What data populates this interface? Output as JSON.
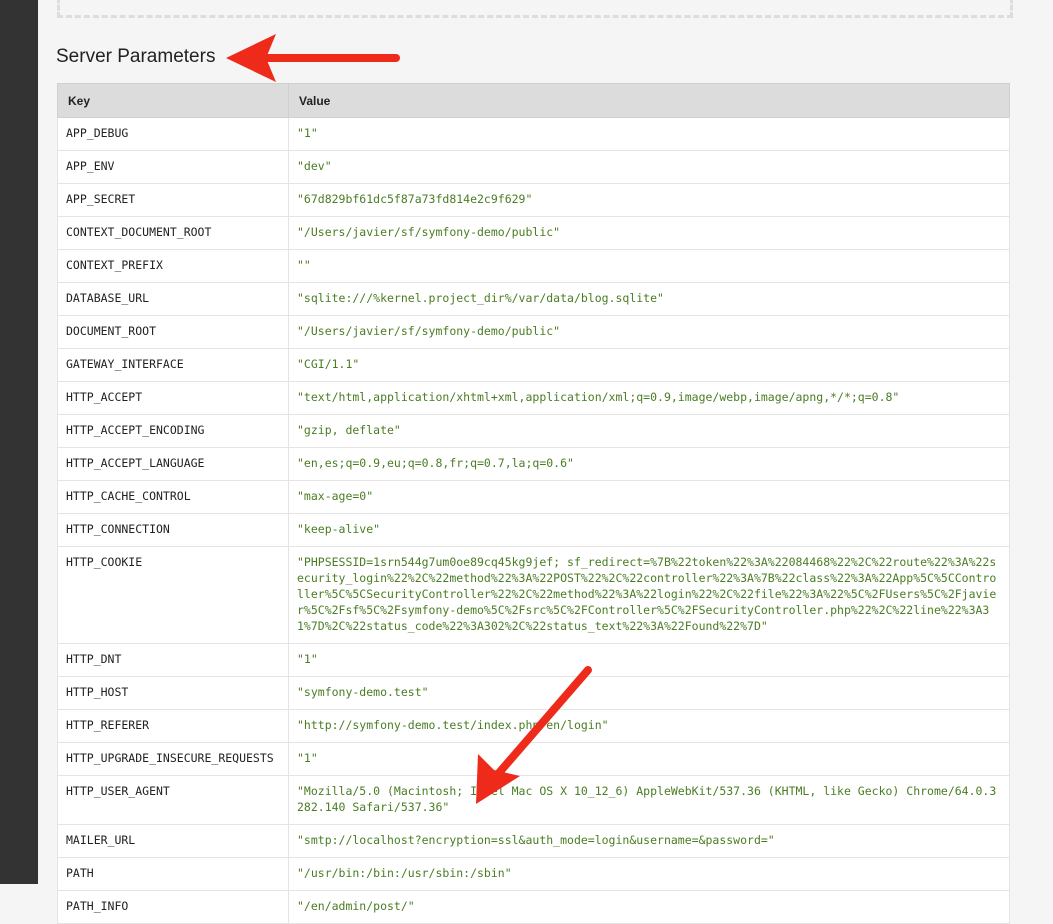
{
  "section_title": "Server Parameters",
  "table": {
    "headers": {
      "key": "Key",
      "value": "Value"
    },
    "rows": [
      {
        "key": "APP_DEBUG",
        "value": "\"1\""
      },
      {
        "key": "APP_ENV",
        "value": "\"dev\""
      },
      {
        "key": "APP_SECRET",
        "value": "\"67d829bf61dc5f87a73fd814e2c9f629\""
      },
      {
        "key": "CONTEXT_DOCUMENT_ROOT",
        "value": "\"/Users/javier/sf/symfony-demo/public\""
      },
      {
        "key": "CONTEXT_PREFIX",
        "value": "\"\""
      },
      {
        "key": "DATABASE_URL",
        "value": "\"sqlite:///%kernel.project_dir%/var/data/blog.sqlite\""
      },
      {
        "key": "DOCUMENT_ROOT",
        "value": "\"/Users/javier/sf/symfony-demo/public\""
      },
      {
        "key": "GATEWAY_INTERFACE",
        "value": "\"CGI/1.1\""
      },
      {
        "key": "HTTP_ACCEPT",
        "value": "\"text/html,application/xhtml+xml,application/xml;q=0.9,image/webp,image/apng,*/*;q=0.8\""
      },
      {
        "key": "HTTP_ACCEPT_ENCODING",
        "value": "\"gzip, deflate\""
      },
      {
        "key": "HTTP_ACCEPT_LANGUAGE",
        "value": "\"en,es;q=0.9,eu;q=0.8,fr;q=0.7,la;q=0.6\""
      },
      {
        "key": "HTTP_CACHE_CONTROL",
        "value": "\"max-age=0\""
      },
      {
        "key": "HTTP_CONNECTION",
        "value": "\"keep-alive\""
      },
      {
        "key": "HTTP_COOKIE",
        "value": "\"PHPSESSID=1srn544g7um0oe89cq45kg9jef; sf_redirect=%7B%22token%22%3A%22084468%22%2C%22route%22%3A%22security_login%22%2C%22method%22%3A%22POST%22%2C%22controller%22%3A%7B%22class%22%3A%22App%5C%5CController%5C%5CSecurityController%22%2C%22method%22%3A%22login%22%2C%22file%22%3A%22%5C%2FUsers%5C%2Fjavier%5C%2Fsf%5C%2Fsymfony-demo%5C%2Fsrc%5C%2FController%5C%2FSecurityController.php%22%2C%22line%22%3A31%7D%2C%22status_code%22%3A302%2C%22status_text%22%3A%22Found%22%7D\""
      },
      {
        "key": "HTTP_DNT",
        "value": "\"1\""
      },
      {
        "key": "HTTP_HOST",
        "value": "\"symfony-demo.test\""
      },
      {
        "key": "HTTP_REFERER",
        "value": "\"http://symfony-demo.test/index.php/en/login\""
      },
      {
        "key": "HTTP_UPGRADE_INSECURE_REQUESTS",
        "value": "\"1\""
      },
      {
        "key": "HTTP_USER_AGENT",
        "value": "\"Mozilla/5.0 (Macintosh; Intel Mac OS X 10_12_6) AppleWebKit/537.36 (KHTML, like Gecko) Chrome/64.0.3282.140 Safari/537.36\""
      },
      {
        "key": "MAILER_URL",
        "value": "\"smtp://localhost?encryption=ssl&auth_mode=login&username=&password=\""
      },
      {
        "key": "PATH",
        "value": "\"/usr/bin:/bin:/usr/sbin:/sbin\""
      },
      {
        "key": "PATH_INFO",
        "value": "\"/en/admin/post/\""
      }
    ]
  },
  "colors": {
    "value_text": "#4a7d23",
    "annotation_arrow": "#ee2a1b",
    "sidebar": "#333333",
    "header_bg": "#dcdcdc"
  }
}
